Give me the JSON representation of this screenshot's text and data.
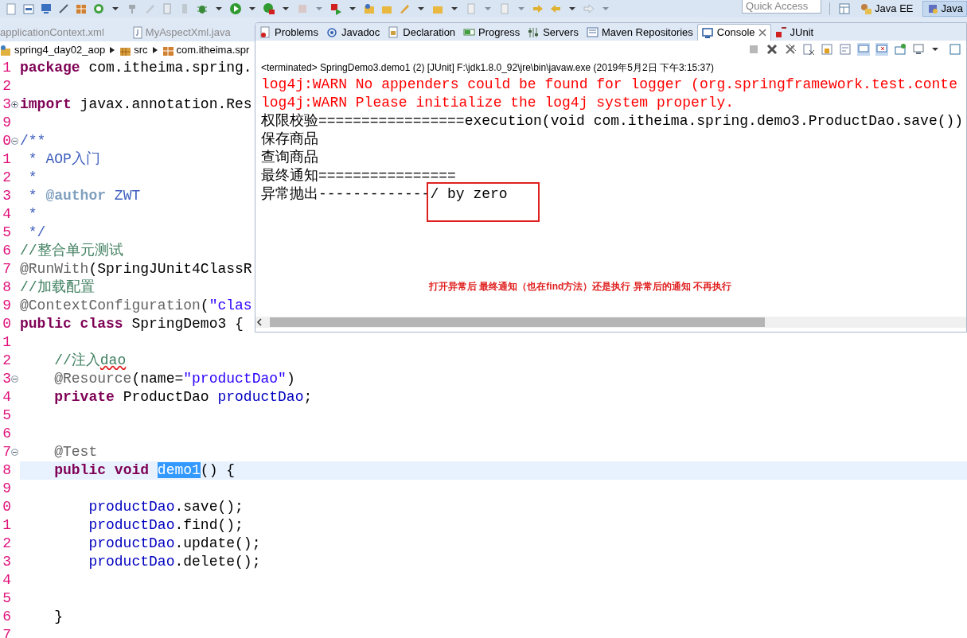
{
  "toolbar": {
    "quick_access": {
      "placeholder": "Quick Access"
    },
    "perspectives": [
      {
        "label": "Java EE",
        "selected": false
      },
      {
        "label": "Java",
        "selected": true
      }
    ]
  },
  "editor": {
    "tabs": [
      {
        "label": "applicationContext.xml",
        "selected": false
      },
      {
        "label": "MyAspectXml.java",
        "selected": false
      }
    ],
    "breadcrumb": [
      "spring4_day02_aop",
      "src",
      "com.itheima.spr"
    ],
    "lines": [
      {
        "number": "1",
        "highlighted": false,
        "tokens": [
          {
            "kind": "keyword",
            "text": "package"
          },
          {
            "kind": "plain",
            "text": " com.itheima.spring."
          }
        ]
      },
      {
        "number": "2",
        "highlighted": false
      },
      {
        "number": "3",
        "collapsed": true,
        "highlighted": false,
        "tokens": [
          {
            "kind": "keyword",
            "text": "import"
          },
          {
            "kind": "plain",
            "text": " javax.annotation.Res"
          }
        ]
      },
      {
        "number": "9",
        "highlighted": false
      },
      {
        "number": "0",
        "collapsed": false,
        "highlighted": false,
        "tokens": [
          {
            "kind": "javadoc",
            "text": "/**"
          }
        ]
      },
      {
        "number": "1",
        "highlighted": false,
        "tokens": [
          {
            "kind": "javadoc",
            "text": " * AOP入门"
          }
        ]
      },
      {
        "number": "2",
        "highlighted": false,
        "tokens": [
          {
            "kind": "javadoc",
            "text": " *"
          }
        ]
      },
      {
        "number": "3",
        "highlighted": false,
        "tokens": [
          {
            "kind": "javadoc",
            "text": " * "
          },
          {
            "kind": "javadoc_tag",
            "text": "@author"
          },
          {
            "kind": "javadoc",
            "text": " ZWT"
          }
        ]
      },
      {
        "number": "4",
        "highlighted": false,
        "tokens": [
          {
            "kind": "javadoc",
            "text": " *"
          }
        ]
      },
      {
        "number": "5",
        "highlighted": false,
        "tokens": [
          {
            "kind": "javadoc",
            "text": " */"
          }
        ]
      },
      {
        "number": "6",
        "highlighted": false,
        "tokens": [
          {
            "kind": "comment",
            "text": "//整合单元测试"
          }
        ]
      },
      {
        "number": "7",
        "highlighted": false,
        "tokens": [
          {
            "kind": "annotation",
            "text": "@RunWith"
          },
          {
            "kind": "plain",
            "text": "(SpringJUnit4ClassR"
          }
        ]
      },
      {
        "number": "8",
        "highlighted": false,
        "tokens": [
          {
            "kind": "comment",
            "text": "//加载配置"
          }
        ]
      },
      {
        "number": "9",
        "highlighted": false,
        "tokens": [
          {
            "kind": "annotation",
            "text": "@ContextConfiguration"
          },
          {
            "kind": "plain",
            "text": "("
          },
          {
            "kind": "string",
            "text": "\"clas"
          }
        ]
      },
      {
        "number": "0",
        "highlighted": false,
        "tokens": [
          {
            "kind": "keyword",
            "text": "public"
          },
          {
            "kind": "keyword",
            "text": " class"
          },
          {
            "kind": "plain",
            "text": " SpringDemo3 {"
          }
        ]
      },
      {
        "number": "1",
        "highlighted": false
      },
      {
        "number": "2",
        "highlighted": false,
        "tokens": [
          {
            "kind": "comment",
            "text": "    //注入"
          },
          {
            "kind": "comment",
            "text": "dao",
            "misspelled": true
          }
        ]
      },
      {
        "number": "3",
        "collapsed": false,
        "highlighted": false,
        "tokens": [
          {
            "kind": "annotation",
            "text": "    @Resource"
          },
          {
            "kind": "plain",
            "text": "(name="
          },
          {
            "kind": "string",
            "text": "\"productDao\""
          },
          {
            "kind": "plain",
            "text": ")"
          }
        ]
      },
      {
        "number": "4",
        "highlighted": false,
        "tokens": [
          {
            "kind": "keyword",
            "text": "    private"
          },
          {
            "kind": "plain",
            "text": " ProductDao "
          },
          {
            "kind": "field",
            "text": "productDao"
          },
          {
            "kind": "plain",
            "text": ";"
          }
        ]
      },
      {
        "number": "5",
        "highlighted": false
      },
      {
        "number": "6",
        "highlighted": false
      },
      {
        "number": "7",
        "collapsed": false,
        "highlighted": false,
        "tokens": [
          {
            "kind": "annotation",
            "text": "    @Test"
          }
        ]
      },
      {
        "number": "8",
        "highlighted": true,
        "tokens": [
          {
            "kind": "keyword",
            "text": "    public"
          },
          {
            "kind": "keyword",
            "text": " void "
          },
          {
            "kind": "selection",
            "text": "demo1"
          },
          {
            "kind": "plain",
            "text": "() {"
          }
        ]
      },
      {
        "number": "9",
        "highlighted": false
      },
      {
        "number": "0",
        "highlighted": false,
        "tokens": [
          {
            "kind": "field",
            "text": "        productDao"
          },
          {
            "kind": "plain",
            "text": ".save();"
          }
        ]
      },
      {
        "number": "1",
        "highlighted": false,
        "tokens": [
          {
            "kind": "field",
            "text": "        productDao"
          },
          {
            "kind": "plain",
            "text": ".find();"
          }
        ]
      },
      {
        "number": "2",
        "highlighted": false,
        "tokens": [
          {
            "kind": "field",
            "text": "        productDao"
          },
          {
            "kind": "plain",
            "text": ".update();"
          }
        ]
      },
      {
        "number": "3",
        "highlighted": false,
        "tokens": [
          {
            "kind": "field",
            "text": "        productDao"
          },
          {
            "kind": "plain",
            "text": ".delete();"
          }
        ]
      },
      {
        "number": "4",
        "highlighted": false
      },
      {
        "number": "5",
        "highlighted": false
      },
      {
        "number": "6",
        "highlighted": false,
        "tokens": [
          {
            "kind": "plain",
            "text": "    }"
          }
        ]
      },
      {
        "number": "7",
        "highlighted": false
      }
    ]
  },
  "console": {
    "tabs": [
      {
        "label": "Problems",
        "selected": false
      },
      {
        "label": "Javadoc",
        "selected": false
      },
      {
        "label": "Declaration",
        "selected": false
      },
      {
        "label": "Progress",
        "selected": false
      },
      {
        "label": "Servers",
        "selected": false
      },
      {
        "label": "Maven Repositories",
        "selected": false
      },
      {
        "label": "Console",
        "selected": true,
        "closable": true
      },
      {
        "label": "JUnit",
        "selected": false
      }
    ],
    "header": "<terminated> SpringDemo3.demo1 (2) [JUnit] F:\\jdk1.8.0_92\\jre\\bin\\javaw.exe (2019年5月2日 下午3:15:37)",
    "lines": [
      {
        "kind": "error",
        "text": "log4j:WARN No appenders could be found for logger (org.springframework.test.conte"
      },
      {
        "kind": "error",
        "text": "log4j:WARN Please initialize the log4j system properly."
      },
      {
        "kind": "output",
        "text": "权限校验=================execution(void com.itheima.spring.demo3.ProductDao.save())"
      },
      {
        "kind": "output",
        "text": "保存商品"
      },
      {
        "kind": "output",
        "text": "查询商品"
      },
      {
        "kind": "output",
        "text": "最终通知================"
      },
      {
        "kind": "output",
        "text": "异常抛出-------------/ by zero"
      }
    ],
    "note": "打开异常后 最终通知（也在find方法）还是执行 异常后的通知 不再执行"
  }
}
